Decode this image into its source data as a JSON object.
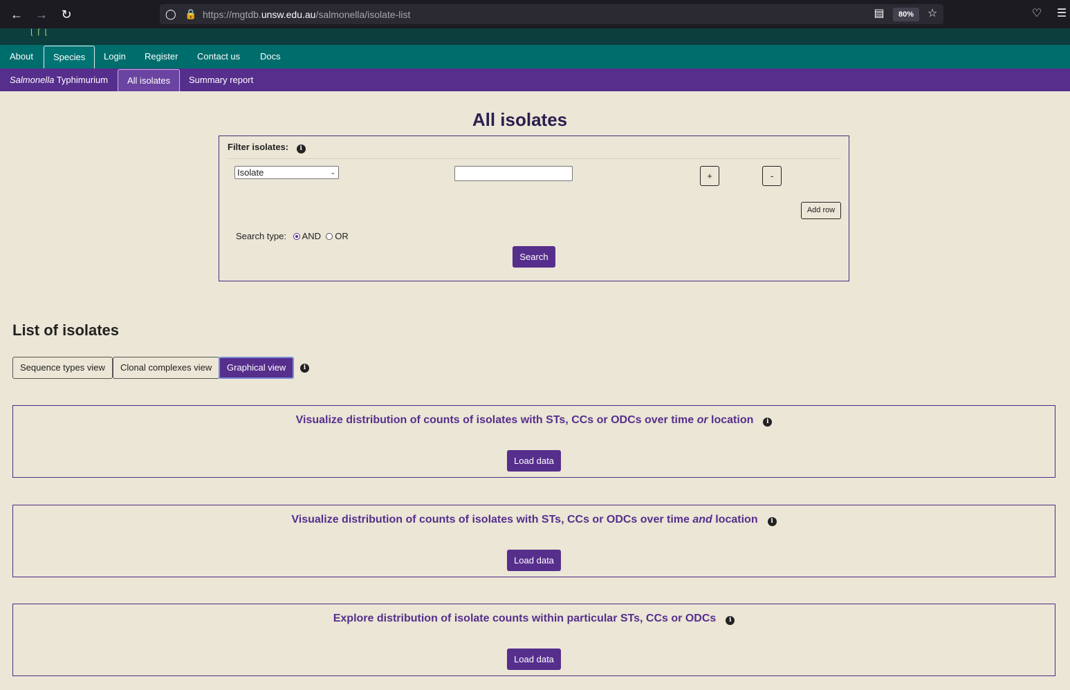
{
  "browser": {
    "url_prefix": "https://mgtdb.",
    "url_host": "unsw.edu.au",
    "url_path": "/salmonella/isolate-list",
    "zoom": "80%"
  },
  "main_nav": {
    "items": [
      "About",
      "Species",
      "Login",
      "Register",
      "Contact us",
      "Docs"
    ],
    "active": "Species"
  },
  "sub_nav": {
    "species_italic": "Salmonella",
    "species_rest": " Typhimurium",
    "all_isolates": "All isolates",
    "summary_report": "Summary report",
    "active": "All isolates"
  },
  "page_title": "All isolates",
  "filter": {
    "label": "Filter isolates:",
    "field_selected": "Isolate",
    "field_value": "",
    "plus_label": "+",
    "minus_label": "-",
    "add_row_label": "Add row",
    "search_type_label": "Search type:",
    "search_type_options": [
      "AND",
      "OR"
    ],
    "search_type_selected": "AND",
    "search_label": "Search"
  },
  "list": {
    "title": "List of isolates",
    "views": [
      "Sequence types view",
      "Clonal complexes view",
      "Graphical view"
    ],
    "active_view": "Graphical view"
  },
  "viz": [
    {
      "title_before": "Visualize distribution of counts of isolates with STs, CCs or ODCs over time ",
      "title_em": "or",
      "title_after": " location",
      "button": "Load data"
    },
    {
      "title_before": "Visualize distribution of counts of isolates with STs, CCs or ODCs over time ",
      "title_em": "and",
      "title_after": " location",
      "button": "Load data"
    },
    {
      "title_before": "Explore distribution of isolate counts within particular STs, CCs or ODCs",
      "title_em": "",
      "title_after": "",
      "button": "Load data"
    }
  ],
  "colors": {
    "teal_nav": "#006d6d",
    "purple_nav": "#562e8c",
    "page_bg": "#ebe6d6"
  }
}
